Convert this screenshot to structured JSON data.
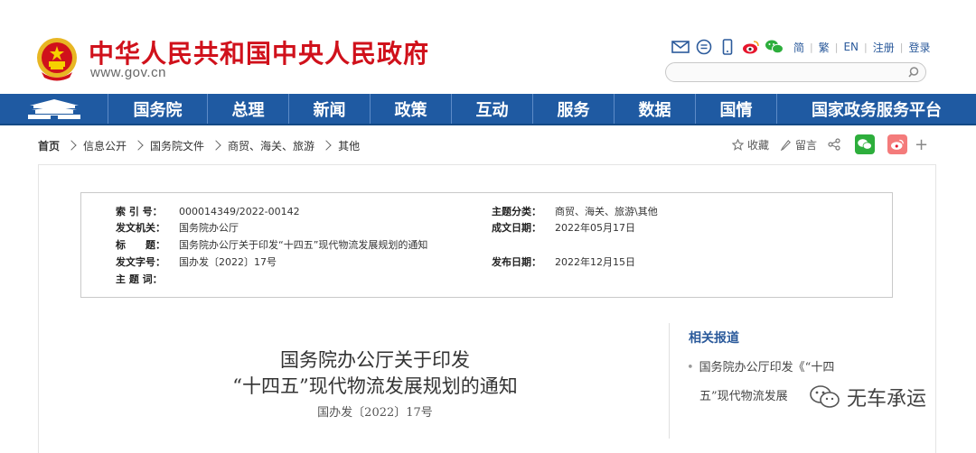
{
  "header": {
    "site_name": "中华人民共和国中央人民政府",
    "site_url": "www.gov.cn",
    "links": [
      "简",
      "繁",
      "EN",
      "注册",
      "登录"
    ],
    "search_placeholder": ""
  },
  "nav": {
    "items": [
      "国务院",
      "总理",
      "新闻",
      "政策",
      "互动",
      "服务",
      "数据",
      "国情",
      "国家政务服务平台"
    ]
  },
  "breadcrumb": [
    "首页",
    "信息公开",
    "国务院文件",
    "商贸、海关、旅游",
    "其他"
  ],
  "share": {
    "favorite": "收藏",
    "comment": "留言"
  },
  "meta": {
    "index_label": "索 引 号：",
    "index_value": "000014349/2022-00142",
    "topic_label": "主题分类：",
    "topic_value": "商贸、海关、旅游\\其他",
    "issuer_label": "发文机关：",
    "issuer_value": "国务院办公厅",
    "written_label": "成文日期：",
    "written_value": "2022年05月17日",
    "title_label": "标　　题：",
    "title_value": "国务院办公厅关于印发“十四五”现代物流发展规划的通知",
    "docno_label": "发文字号：",
    "docno_value": "国办发〔2022〕17号",
    "publish_label": "发布日期：",
    "publish_value": "2022年12月15日",
    "keywords_label": "主 题 词："
  },
  "article": {
    "title_line1": "国务院办公厅关于印发",
    "title_line2": "“十四五”现代物流发展规划的通知",
    "doc_number": "国办发〔2022〕17号"
  },
  "related": {
    "heading": "相关报道",
    "item_line1": "国务院办公厅印发《“十四",
    "item_line2": "五”现代物流发展"
  },
  "watermark": "无车承运",
  "colors": {
    "brand_red": "#d0111b",
    "nav_blue": "#1f5aa2",
    "link_blue": "#2b5a9b"
  }
}
